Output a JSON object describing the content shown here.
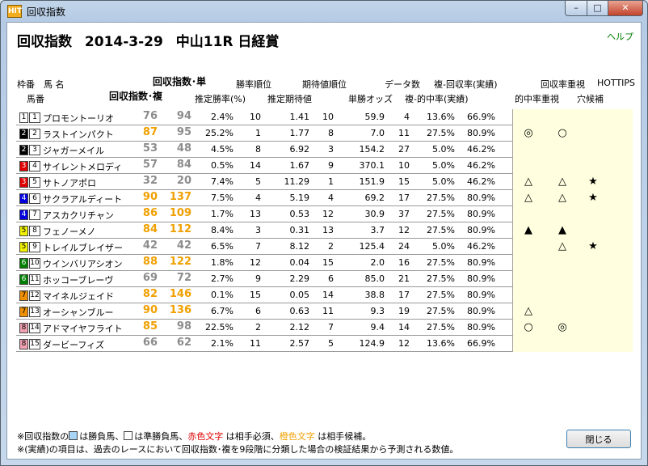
{
  "window": {
    "title": "回収指数",
    "icon": "hit-app-icon",
    "min": "–",
    "max": "□",
    "close": "✕"
  },
  "heading": {
    "label": "回収指数",
    "date": "2014-3-29",
    "race": "中山11R 日経賞"
  },
  "help": "ヘルプ",
  "header_row1": {
    "waku_uma": "枠番　馬 名",
    "index_tan": "回収指数･単",
    "win_rank": "勝率順位",
    "ev_rank": "期待値順位",
    "data_count": "データ数",
    "fuku_rate": "複-回収率(実績)",
    "rate_priority": "回収率重視",
    "hottips": "HOTTIPS"
  },
  "header_row2": {
    "umaban": "馬番",
    "index_fuku": "回収指数･複",
    "est_win": "推定勝率(%)",
    "est_ev": "推定期待値",
    "odds": "単勝オッズ",
    "hit_rate": "複-的中率(実績)",
    "hit_priority": "的中率重視",
    "dark": "穴候補"
  },
  "colors": {
    "frame": [
      "#ffffff",
      "#000000",
      "#000000",
      "#e00000",
      "#e00000",
      "#0000e0",
      "#0000e0",
      "#f0f000",
      "#f0f000",
      "#008000",
      "#008000",
      "#f09000",
      "#f09000",
      "#f0a0b0",
      "#f0a0b0"
    ]
  },
  "rows": [
    {
      "waku": "1",
      "num": "1",
      "name": "プロモントーリオ",
      "tan": "76",
      "fuku": "94",
      "tanc": "gray",
      "fukuc": "gray",
      "winp": "2.4%",
      "wrank": "10",
      "ev": "1.41",
      "erank": "10",
      "odds": "59.9",
      "cnt": "4",
      "hit": "13.6%",
      "rec": "66.9%",
      "m1": "",
      "m2": "",
      "m3": ""
    },
    {
      "waku": "2",
      "num": "2",
      "name": "ラストインパクト",
      "tan": "87",
      "fuku": "95",
      "tanc": "org",
      "fukuc": "gray",
      "winp": "25.2%",
      "wrank": "1",
      "ev": "1.77",
      "erank": "8",
      "odds": "7.0",
      "cnt": "11",
      "hit": "27.5%",
      "rec": "80.9%",
      "m1": "◎",
      "m2": "○",
      "m3": ""
    },
    {
      "waku": "2",
      "num": "3",
      "name": "ジャガーメイル",
      "tan": "53",
      "fuku": "48",
      "tanc": "gray",
      "fukuc": "gray",
      "winp": "4.5%",
      "wrank": "8",
      "ev": "6.92",
      "erank": "3",
      "odds": "154.2",
      "cnt": "27",
      "hit": "5.0%",
      "rec": "46.2%",
      "m1": "",
      "m2": "",
      "m3": ""
    },
    {
      "waku": "3",
      "num": "4",
      "name": "サイレントメロディ",
      "tan": "57",
      "fuku": "84",
      "tanc": "gray",
      "fukuc": "gray",
      "winp": "0.5%",
      "wrank": "14",
      "ev": "1.67",
      "erank": "9",
      "odds": "370.1",
      "cnt": "10",
      "hit": "5.0%",
      "rec": "46.2%",
      "m1": "",
      "m2": "",
      "m3": ""
    },
    {
      "waku": "3",
      "num": "5",
      "name": "サトノアポロ",
      "tan": "32",
      "fuku": "20",
      "tanc": "gray",
      "fukuc": "gray",
      "winp": "7.4%",
      "wrank": "5",
      "ev": "11.29",
      "erank": "1",
      "odds": "151.9",
      "cnt": "15",
      "hit": "5.0%",
      "rec": "46.2%",
      "m1": "△",
      "m2": "△",
      "m3": "★"
    },
    {
      "waku": "4",
      "num": "6",
      "name": "サクラアルディート",
      "tan": "90",
      "fuku": "137",
      "tanc": "org",
      "fukuc": "org",
      "winp": "7.5%",
      "wrank": "4",
      "ev": "5.19",
      "erank": "4",
      "odds": "69.2",
      "cnt": "17",
      "hit": "27.5%",
      "rec": "80.9%",
      "m1": "△",
      "m2": "△",
      "m3": "★"
    },
    {
      "waku": "4",
      "num": "7",
      "name": "アスカクリチャン",
      "tan": "86",
      "fuku": "109",
      "tanc": "org",
      "fukuc": "org",
      "winp": "1.7%",
      "wrank": "13",
      "ev": "0.53",
      "erank": "12",
      "odds": "30.9",
      "cnt": "37",
      "hit": "27.5%",
      "rec": "80.9%",
      "m1": "",
      "m2": "",
      "m3": ""
    },
    {
      "waku": "5",
      "num": "8",
      "name": "フェノーメノ",
      "tan": "84",
      "fuku": "112",
      "tanc": "org",
      "fukuc": "org",
      "winp": "8.4%",
      "wrank": "3",
      "ev": "0.31",
      "erank": "13",
      "odds": "3.7",
      "cnt": "12",
      "hit": "27.5%",
      "rec": "80.9%",
      "m1": "▲",
      "m2": "▲",
      "m3": ""
    },
    {
      "waku": "5",
      "num": "9",
      "name": "トレイルブレイザー",
      "tan": "42",
      "fuku": "42",
      "tanc": "gray",
      "fukuc": "gray",
      "winp": "6.5%",
      "wrank": "7",
      "ev": "8.12",
      "erank": "2",
      "odds": "125.4",
      "cnt": "24",
      "hit": "5.0%",
      "rec": "46.2%",
      "m1": "",
      "m2": "△",
      "m3": "★"
    },
    {
      "waku": "6",
      "num": "10",
      "name": "ウインバリアシオン",
      "tan": "88",
      "fuku": "122",
      "tanc": "org",
      "fukuc": "org",
      "winp": "1.8%",
      "wrank": "12",
      "ev": "0.04",
      "erank": "15",
      "odds": "2.0",
      "cnt": "16",
      "hit": "27.5%",
      "rec": "80.9%",
      "m1": "",
      "m2": "",
      "m3": ""
    },
    {
      "waku": "6",
      "num": "11",
      "name": "ホッコーブレーヴ",
      "tan": "69",
      "fuku": "72",
      "tanc": "gray",
      "fukuc": "gray",
      "winp": "2.7%",
      "wrank": "9",
      "ev": "2.29",
      "erank": "6",
      "odds": "85.0",
      "cnt": "21",
      "hit": "27.5%",
      "rec": "80.9%",
      "m1": "",
      "m2": "",
      "m3": ""
    },
    {
      "waku": "7",
      "num": "12",
      "name": "マイネルジェイド",
      "tan": "82",
      "fuku": "146",
      "tanc": "org",
      "fukuc": "org",
      "winp": "0.1%",
      "wrank": "15",
      "ev": "0.05",
      "erank": "14",
      "odds": "38.8",
      "cnt": "17",
      "hit": "27.5%",
      "rec": "80.9%",
      "m1": "",
      "m2": "",
      "m3": ""
    },
    {
      "waku": "7",
      "num": "13",
      "name": "オーシャンブルー",
      "tan": "90",
      "fuku": "136",
      "tanc": "org",
      "fukuc": "org",
      "winp": "6.7%",
      "wrank": "6",
      "ev": "0.63",
      "erank": "11",
      "odds": "9.3",
      "cnt": "19",
      "hit": "27.5%",
      "rec": "80.9%",
      "m1": "△",
      "m2": "",
      "m3": ""
    },
    {
      "waku": "8",
      "num": "14",
      "name": "アドマイヤフライト",
      "tan": "85",
      "fuku": "98",
      "tanc": "org",
      "fukuc": "gray",
      "winp": "22.5%",
      "wrank": "2",
      "ev": "2.12",
      "erank": "7",
      "odds": "9.4",
      "cnt": "14",
      "hit": "27.5%",
      "rec": "80.9%",
      "m1": "○",
      "m2": "◎",
      "m3": ""
    },
    {
      "waku": "8",
      "num": "15",
      "name": "ダービーフィズ",
      "tan": "66",
      "fuku": "62",
      "tanc": "gray",
      "fukuc": "gray",
      "winp": "2.1%",
      "wrank": "11",
      "ev": "2.57",
      "erank": "5",
      "odds": "124.9",
      "cnt": "12",
      "hit": "13.6%",
      "rec": "66.9%",
      "m1": "",
      "m2": "",
      "m3": ""
    }
  ],
  "footer": {
    "l1a": "※回収指数の",
    "l1b": "は勝負馬、",
    "l1c": "は準勝負馬、",
    "red": "赤色文字",
    "l1d": " は相手必須、",
    "orange": "橙色文字",
    "l1e": " は相手候補。",
    "l2": "※(実績)の項目は、過去のレースにおいて回収指数･複を9段階に分類した場合の検証結果から予測される数値。"
  },
  "close_button": "閉じる"
}
